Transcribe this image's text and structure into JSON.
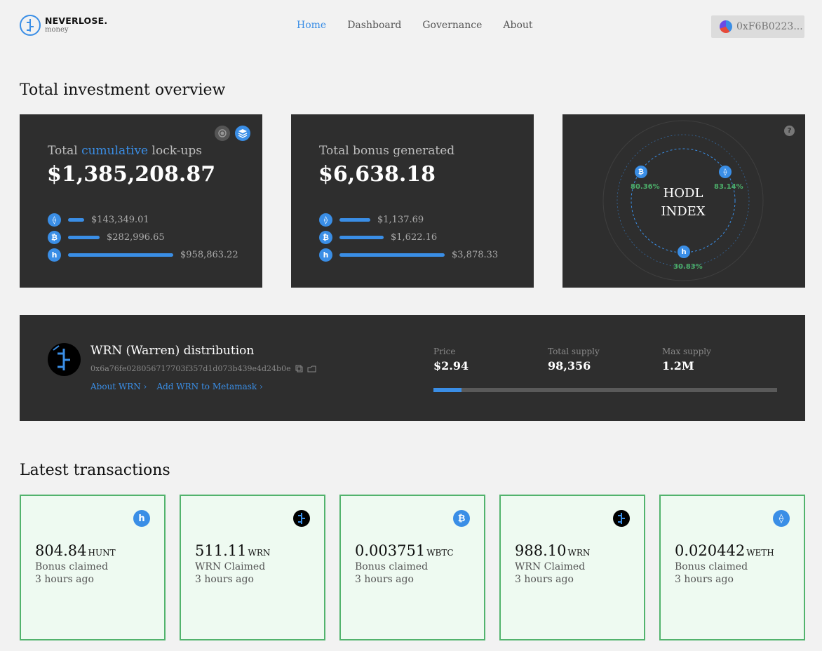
{
  "header": {
    "brand_name": "NEVERLOSE.",
    "brand_sub": "money",
    "nav": [
      "Home",
      "Dashboard",
      "Governance",
      "About"
    ],
    "active_nav": "Home",
    "wallet_address": "0xF6B0223..."
  },
  "overview": {
    "section_title": "Total investment overview",
    "lockups": {
      "title_pre": "Total",
      "title_hl": "cumulative",
      "title_post": "lock-ups",
      "total": "$1,385,208.87",
      "rows": [
        {
          "icon": "eth-icon",
          "glyph": "⟠",
          "value": "$143,349.01",
          "share": 0.15
        },
        {
          "icon": "btc-icon",
          "glyph": "₿",
          "value": "$282,996.65",
          "share": 0.3
        },
        {
          "icon": "hunt-icon",
          "glyph": "h",
          "value": "$958,863.22",
          "share": 1.0
        }
      ]
    },
    "bonus": {
      "title": "Total bonus generated",
      "total": "$6,638.18",
      "rows": [
        {
          "icon": "eth-icon",
          "glyph": "⟠",
          "value": "$1,137.69",
          "share": 0.29
        },
        {
          "icon": "btc-icon",
          "glyph": "₿",
          "value": "$1,622.16",
          "share": 0.42
        },
        {
          "icon": "hunt-icon",
          "glyph": "h",
          "value": "$3,878.33",
          "share": 1.0
        }
      ]
    },
    "hodl": {
      "line1": "HODL",
      "line2": "INDEX",
      "btc": "80.36%",
      "eth": "83.14%",
      "hunt": "30.83%"
    }
  },
  "wrn": {
    "title": "WRN (Warren) distribution",
    "address": "0x6a76fe028056717703f357d1d073b439e4d24b0e",
    "link_about": "About WRN",
    "link_metamask": "Add WRN to Metamask",
    "price_label": "Price",
    "price": "$2.94",
    "supply_label": "Total supply",
    "supply": "98,356",
    "max_label": "Max supply",
    "max": "1.2M",
    "supply_fraction": 0.082
  },
  "transactions": {
    "section_title": "Latest transactions",
    "items": [
      {
        "icon": "hunt-icon",
        "glyph": "h",
        "amount": "804.84",
        "unit": "HUNT",
        "desc": "Bonus claimed",
        "time": "3 hours ago"
      },
      {
        "icon": "wrn-icon",
        "glyph": "",
        "amount": "511.11",
        "unit": "WRN",
        "desc": "WRN Claimed",
        "time": "3 hours ago"
      },
      {
        "icon": "btc-icon",
        "glyph": "₿",
        "amount": "0.003751",
        "unit": "WBTC",
        "desc": "Bonus claimed",
        "time": "3 hours ago"
      },
      {
        "icon": "wrn-icon",
        "glyph": "",
        "amount": "988.10",
        "unit": "WRN",
        "desc": "WRN Claimed",
        "time": "3 hours ago"
      },
      {
        "icon": "eth-icon",
        "glyph": "⟠",
        "amount": "0.020442",
        "unit": "WETH",
        "desc": "Bonus claimed",
        "time": "3 hours ago"
      }
    ]
  },
  "colors": {
    "accent": "#3a8ee6",
    "card_bg": "#2e2e2e",
    "tx_border": "#52b36d",
    "tx_bg": "#eefaf1",
    "positive": "#4caf6a"
  }
}
